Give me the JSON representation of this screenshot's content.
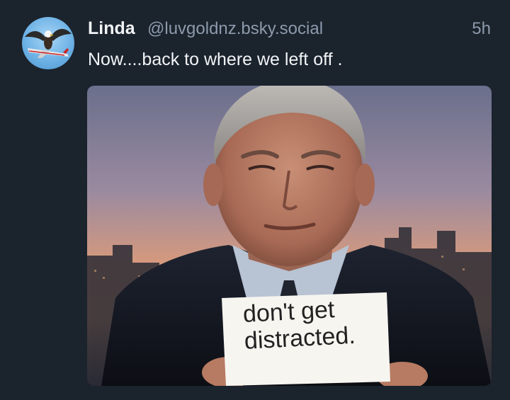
{
  "post": {
    "author_name": "Linda",
    "handle": "@luvgoldnz.bsky.social",
    "time": "5h",
    "text": "Now....back to where we left off .",
    "image": {
      "sign_line1": "don't get",
      "sign_line2": "distracted."
    }
  },
  "colors": {
    "background": "#1b232d",
    "text_primary": "#f1f3f5",
    "text_secondary": "#8c9aab"
  }
}
